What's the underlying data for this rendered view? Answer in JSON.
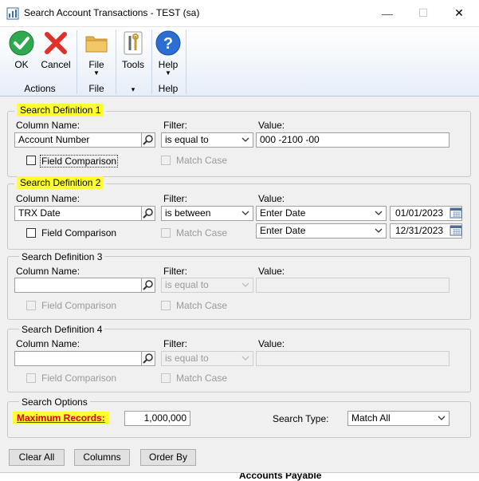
{
  "window": {
    "title": "Search Account Transactions  -  TEST (sa)",
    "minimize_glyph": "—",
    "maximize_glyph": "☐",
    "close_glyph": "✕"
  },
  "ribbon": {
    "ok_label": "OK",
    "cancel_label": "Cancel",
    "actions_group": "Actions",
    "file_label": "File",
    "file_group": "File",
    "tools_label": "Tools",
    "tools_group_caret": "▾",
    "help_label": "Help",
    "help_group": "Help",
    "dropdown_caret": "▼"
  },
  "labels": {
    "column_name": "Column Name:",
    "filter": "Filter:",
    "value": "Value:",
    "field_comparison": "Field Comparison",
    "match_case": "Match Case"
  },
  "search1": {
    "title": "Search Definition 1",
    "column": "Account Number",
    "filter": "is equal to",
    "value": "000 -2100 -00"
  },
  "search2": {
    "title": "Search Definition 2",
    "column": "TRX Date",
    "filter": "is between",
    "from_type": "Enter Date",
    "from_date": "01/01/2023",
    "to_type": "Enter Date",
    "to_date": "12/31/2023"
  },
  "search3": {
    "title": "Search Definition 3",
    "column": "",
    "filter": "is equal to",
    "value": ""
  },
  "search4": {
    "title": "Search Definition 4",
    "column": "",
    "filter": "is equal to",
    "value": ""
  },
  "options": {
    "title": "Search Options",
    "max_records_label": "Maximum Records:",
    "max_records": "1,000,000",
    "search_type_label": "Search Type:",
    "search_type": "Match All"
  },
  "buttons": {
    "clear_all": "Clear All",
    "columns": "Columns",
    "order_by": "Order By"
  },
  "background_text": "Accounts Payable",
  "colors": {
    "highlight": "#ffff33",
    "highlight_text_red": "#d40000",
    "ribbon_gradient_bottom": "#e6eef8"
  }
}
